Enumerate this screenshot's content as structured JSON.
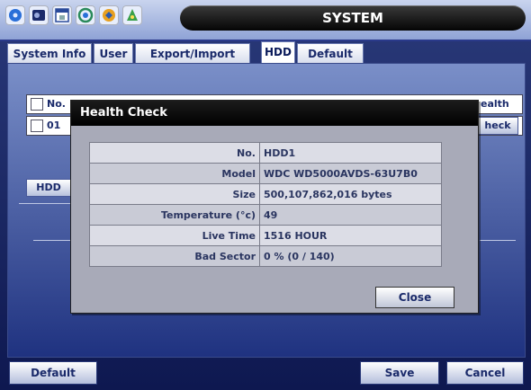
{
  "window": {
    "title": "SYSTEM"
  },
  "menu_icons": [
    "disk-icon",
    "record-icon",
    "calendar-icon",
    "network-icon",
    "devices-icon",
    "event-icon"
  ],
  "tabs": [
    {
      "label": "System Info",
      "active": false
    },
    {
      "label": "User",
      "active": false
    },
    {
      "label": "Export/Import",
      "active": false
    },
    {
      "label": "HDD",
      "active": true
    },
    {
      "label": "Default",
      "active": false
    }
  ],
  "background": {
    "header_no": "No.",
    "header_health": "ealth",
    "row_no": "01",
    "row_check_btn": "heck",
    "hdd_btn": "HDD"
  },
  "modal": {
    "title": "Health Check",
    "rows": [
      {
        "label": "No.",
        "value": "HDD1"
      },
      {
        "label": "Model",
        "value": "WDC WD5000AVDS-63U7B0"
      },
      {
        "label": "Size",
        "value": "500,107,862,016 bytes"
      },
      {
        "label": "Temperature (°c)",
        "value": "49"
      },
      {
        "label": "Live Time",
        "value": "1516 HOUR"
      },
      {
        "label": "Bad Sector",
        "value": "0 % (0 / 140)"
      }
    ],
    "close_label": "Close"
  },
  "bottom": {
    "default_label": "Default",
    "save_label": "Save",
    "cancel_label": "Cancel"
  }
}
